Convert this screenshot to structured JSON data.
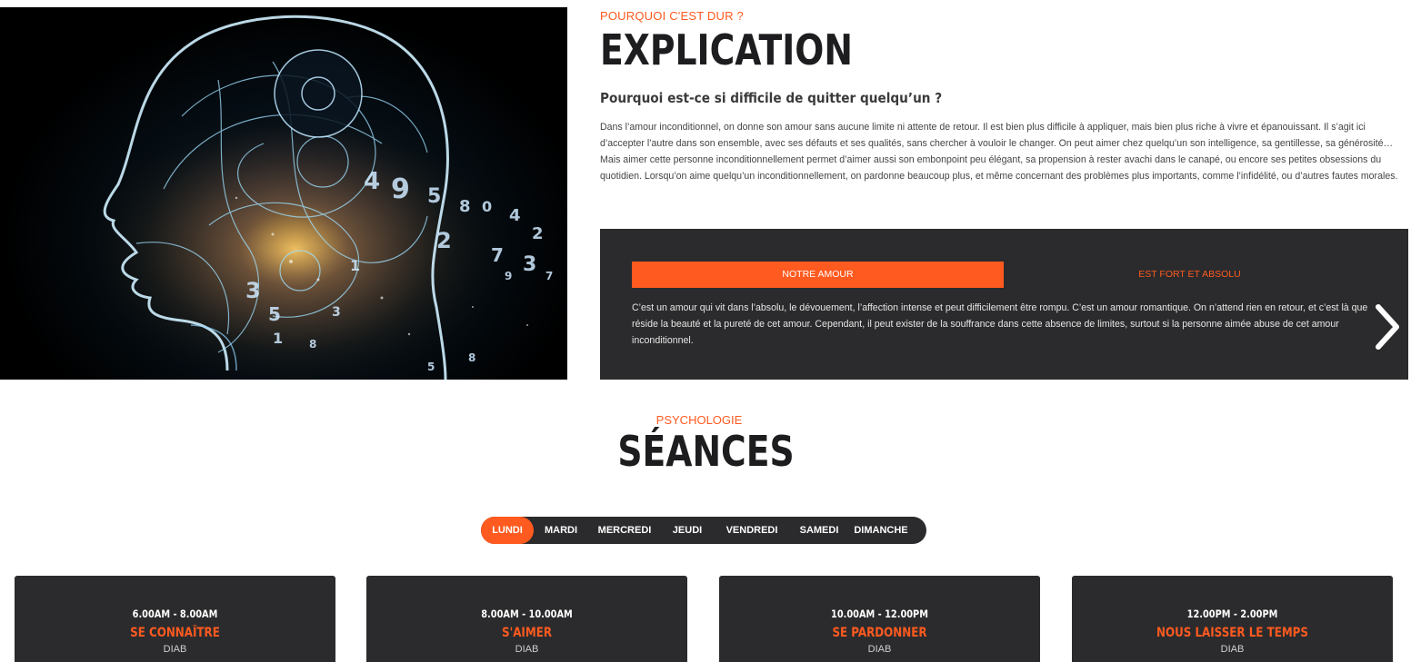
{
  "explication": {
    "eyebrow": "POURQUOI C'EST DUR ?",
    "title": "EXPLICATION",
    "subtitle": "Pourquoi est-ce si difficile de quitter quelqu’un ?",
    "paragraph": "Dans l’amour inconditionnel, on donne son amour sans aucune limite ni attente de retour. Il est bien plus difficile à appliquer, mais bien plus riche à vivre et épanouissant. Il s’agit ici d’accepter l’autre dans son ensemble, avec ses défauts et ses qualités, sans chercher à vouloir le changer. On peut aimer chez quelqu’un son intelligence, sa gentillesse, sa générosité… Mais aimer cette personne inconditionnellement permet d’aimer aussi son embonpoint peu élégant, sa propension à rester avachi dans le canapé, ou encore ses petites obsessions du quotidien. Lorsqu’on aime quelqu’un inconditionnellement, on pardonne beaucoup plus, et même concernant des problèmes plus importants, comme l’infidélité, ou d’autres fautes morales."
  },
  "love_tabs": {
    "active_label": "NOTRE AMOUR",
    "inactive_label": "EST FORT ET ABSOLU",
    "content": "C’est un amour qui vit dans l’absolu, le dévouement, l’affection intense et peut difficilement être rompu. C’est un amour romantique. On n’attend rien en retour, et c’est là que réside la beauté et la pureté de cet amour. Cependant, il peut exister de la souffrance dans cette absence de limites, surtout si la personne aimée abuse de cet amour inconditionnel.",
    "next_icon": "chevron-right-icon"
  },
  "sessions": {
    "eyebrow": "PSYCHOLOGIE",
    "title": "SÉANCES",
    "days": [
      "LUNDI",
      "MARDI",
      "MERCREDI",
      "JEUDI",
      "VENDREDI",
      "SAMEDI",
      "DIMANCHE"
    ],
    "active_day": "LUNDI",
    "cards": [
      {
        "time": "6.00AM - 8.00AM",
        "title": "SE CONNAÎTRE",
        "author": "DIAB"
      },
      {
        "time": "8.00AM - 10.00AM",
        "title": "S'AIMER",
        "author": "DIAB"
      },
      {
        "time": "10.00AM - 12.00PM",
        "title": "SE PARDONNER",
        "author": "DIAB"
      },
      {
        "time": "12.00PM - 2.00PM",
        "title": "NOUS LAISSER LE TEMPS",
        "author": "DIAB"
      }
    ]
  },
  "colors": {
    "accent": "#ff5a1f",
    "dark": "#2b2b2d",
    "heading": "#1d1d1f"
  }
}
